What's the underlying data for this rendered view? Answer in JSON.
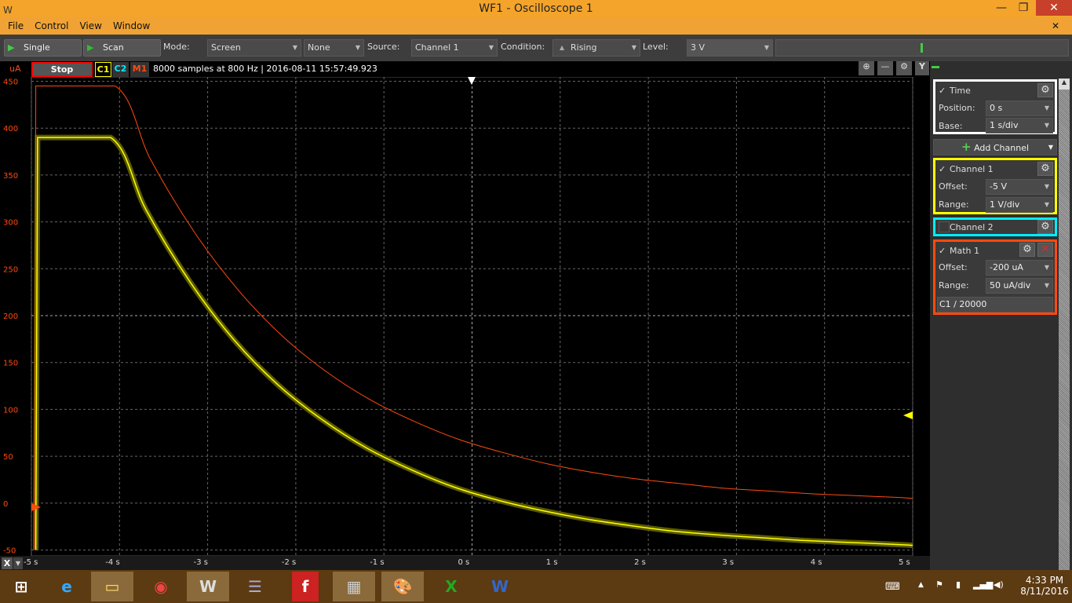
{
  "window": {
    "title": "WF1 - Oscilloscope 1",
    "min": "—",
    "restore": "❐",
    "close": "✕"
  },
  "menu": [
    "File",
    "Control",
    "View",
    "Window"
  ],
  "toolbar": {
    "single": "Single",
    "scan": "Scan",
    "mode_label": "Mode:",
    "mode": "Screen",
    "mode2": "None",
    "source_label": "Source:",
    "source": "Channel 1",
    "condition_label": "Condition:",
    "condition": "Rising",
    "level_label": "Level:",
    "level": "3 V"
  },
  "plot_header": {
    "unit": "uA",
    "stop": "Stop",
    "c1": "C1",
    "c2": "C2",
    "m1": "M1",
    "info": "8000 samples at 800 Hz | 2016-08-11 15:57:49.923",
    "y_btn": "Y"
  },
  "panel": {
    "time": {
      "title": "Time",
      "position_label": "Position:",
      "position": "0 s",
      "base_label": "Base:",
      "base": "1 s/div"
    },
    "add_channel": "Add Channel",
    "channel1": {
      "title": "Channel 1",
      "offset_label": "Offset:",
      "offset": "-5 V",
      "range_label": "Range:",
      "range": "1 V/div"
    },
    "channel2": {
      "title": "Channel 2"
    },
    "math1": {
      "title": "Math 1",
      "offset_label": "Offset:",
      "offset": "-200 uA",
      "range_label": "Range:",
      "range": "50 uA/div",
      "expr": "C1 / 20000"
    }
  },
  "x_button": "X",
  "taskbar": {
    "time": "4:33 PM",
    "date": "8/11/2016"
  },
  "colors": {
    "c1": "#ffff00",
    "c2": "#00e5ff",
    "m1": "#ff4a10"
  },
  "chart_data": {
    "type": "line",
    "xlabel": "",
    "ylabel": "uA",
    "xlim": [
      -5,
      5
    ],
    "ylim": [
      -50,
      450
    ],
    "x_ticks": [
      "-5 s",
      "-4 s",
      "-3 s",
      "-2 s",
      "-1 s",
      "0 s",
      "1 s",
      "2 s",
      "3 s",
      "4 s",
      "5 s"
    ],
    "y_ticks": [
      "450",
      "400",
      "350",
      "300",
      "250",
      "200",
      "150",
      "100",
      "50",
      "0",
      "-50"
    ],
    "grid": true,
    "series": [
      {
        "name": "C1",
        "color": "#ffff00",
        "x": [
          -4.95,
          -4.93,
          -4.1,
          -3.7,
          -3.2,
          -2.7,
          -2.2,
          -1.7,
          -1.2,
          -0.7,
          -0.2,
          0.3,
          0.8,
          1.3,
          1.8,
          2.3,
          2.8,
          3.3,
          3.8,
          4.3,
          4.8,
          5.0
        ],
        "y": [
          -50,
          390,
          390,
          313,
          236,
          174,
          126,
          89,
          59,
          36,
          17,
          3,
          -8,
          -17,
          -24,
          -30,
          -34,
          -37,
          -40,
          -42,
          -44,
          -45
        ]
      },
      {
        "name": "M1",
        "color": "#ff4a10",
        "x": [
          -4.96,
          -4.95,
          -4.05,
          -3.65,
          -3.15,
          -2.65,
          -2.15,
          -1.65,
          -1.15,
          -0.65,
          -0.15,
          0.35,
          0.85,
          1.35,
          1.85,
          2.35,
          2.85,
          3.35,
          3.85,
          4.35,
          4.85,
          5.0
        ],
        "y": [
          -50,
          445,
          445,
          367,
          289,
          227,
          178,
          140,
          110,
          87,
          68,
          54,
          42,
          33,
          26,
          21,
          16,
          13,
          10,
          8,
          6,
          5
        ]
      }
    ]
  }
}
